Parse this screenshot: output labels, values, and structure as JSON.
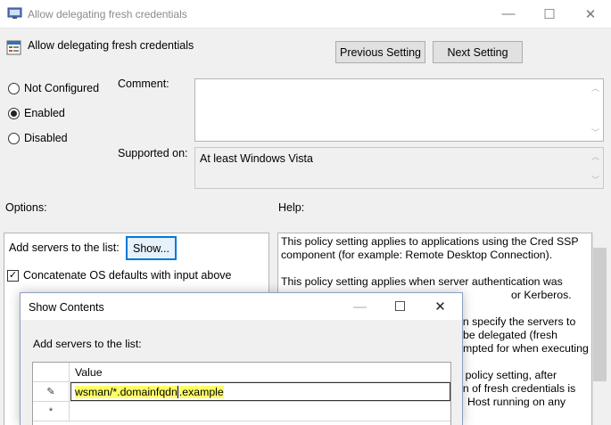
{
  "window": {
    "title": "Allow delegating fresh credentials",
    "minimize_glyph": "—",
    "maximize_glyph": "☐",
    "close_glyph": "✕"
  },
  "header": {
    "policy_title": "Allow delegating fresh credentials",
    "prev_label": "Previous Setting",
    "next_label": "Next Setting"
  },
  "state": {
    "not_configured": "Not Configured",
    "enabled": "Enabled",
    "disabled": "Disabled",
    "selected": "Enabled"
  },
  "comment": {
    "label": "Comment:",
    "value": ""
  },
  "supported": {
    "label": "Supported on:",
    "value": "At least Windows Vista"
  },
  "options": {
    "label": "Options:",
    "add_servers_label": "Add servers to the list:",
    "show_button": "Show...",
    "concat_label": "Concatenate OS defaults with input above",
    "concat_checked": true
  },
  "help": {
    "label": "Help:",
    "p1": "This policy setting applies to applications using the Cred SSP component (for example: Remote Desktop Connection).",
    "p2a": "This policy setting applies when server authentication was",
    "p2b": "or Kerberos.",
    "p3a": "an specify the servers to",
    "p3b": "be delegated (fresh",
    "p3c": "mpted for when executing",
    "p4a": "s policy setting, after",
    "p4b": "on of fresh credentials is",
    "p4c": "Host running on any"
  },
  "dialog": {
    "title": "Show Contents",
    "minimize_glyph": "—",
    "maximize_glyph": "☐",
    "close_glyph": "✕",
    "label": "Add servers to the list:",
    "column_header": "Value",
    "rows": [
      {
        "marker": "✎",
        "value_before_caret": "wsman/*.domainfqdn",
        "value_after_caret": ".example"
      },
      {
        "marker": "*",
        "value_before_caret": "",
        "value_after_caret": ""
      }
    ]
  },
  "colors": {
    "focus_blue": "#0078d7",
    "highlight": "#ffff66"
  }
}
